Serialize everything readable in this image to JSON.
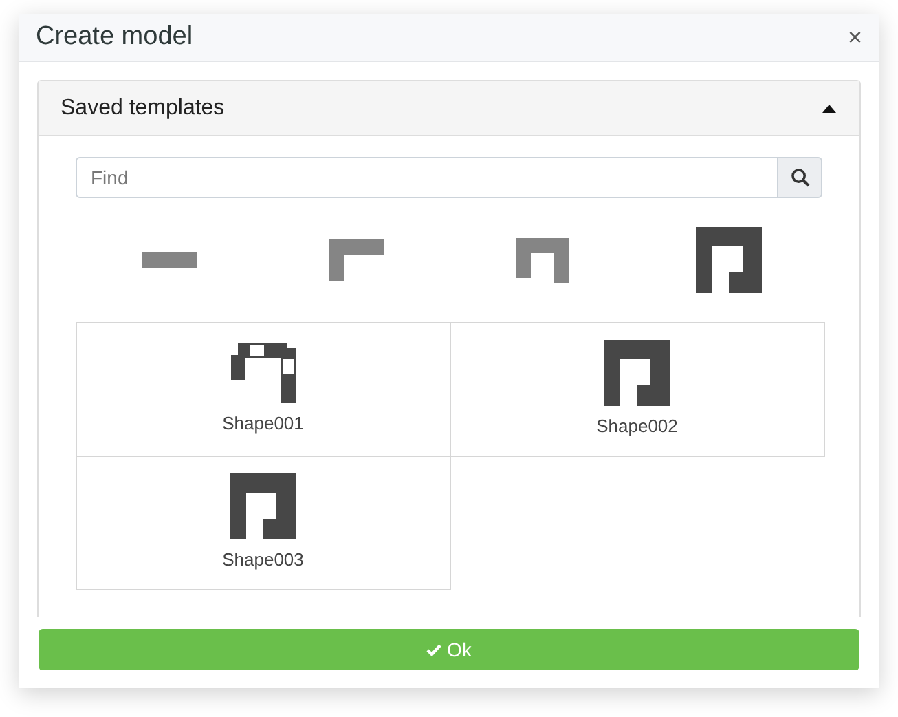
{
  "dialog": {
    "title": "Create model",
    "close": "×"
  },
  "panel": {
    "title": "Saved templates",
    "expanded": true,
    "search": {
      "placeholder": "Find"
    },
    "palette": [
      {
        "kind": "bar",
        "color": "#858585"
      },
      {
        "kind": "corner",
        "color": "#858585"
      },
      {
        "kind": "arch",
        "color": "#858585"
      },
      {
        "kind": "hook",
        "color": "#474747"
      }
    ],
    "templates": [
      {
        "name": "Shape001",
        "kind": "fragment"
      },
      {
        "name": "Shape002",
        "kind": "hook"
      },
      {
        "name": "Shape003",
        "kind": "hook"
      }
    ]
  },
  "ok_button": {
    "label": "Ok"
  }
}
